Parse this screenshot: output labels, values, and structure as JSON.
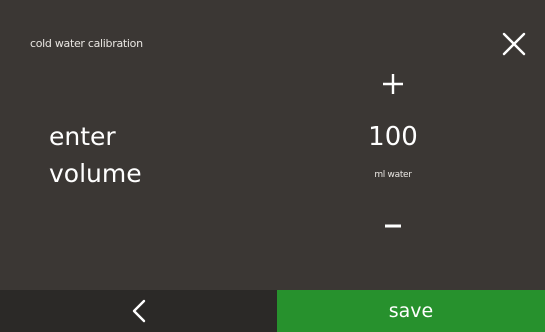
{
  "header": {
    "title": "cold water calibration",
    "close_icon": "close-icon"
  },
  "prompt": {
    "line1": "enter",
    "line2": "volume"
  },
  "stepper": {
    "increment_icon": "plus-icon",
    "value": "100",
    "unit": "ml water",
    "decrement_icon": "minus-icon"
  },
  "footer": {
    "back_icon": "chevron-left-icon",
    "save_label": "save"
  },
  "colors": {
    "background": "#3b3734",
    "footer_dark": "#2b2927",
    "save_green": "#27912d",
    "text": "#ffffff"
  }
}
